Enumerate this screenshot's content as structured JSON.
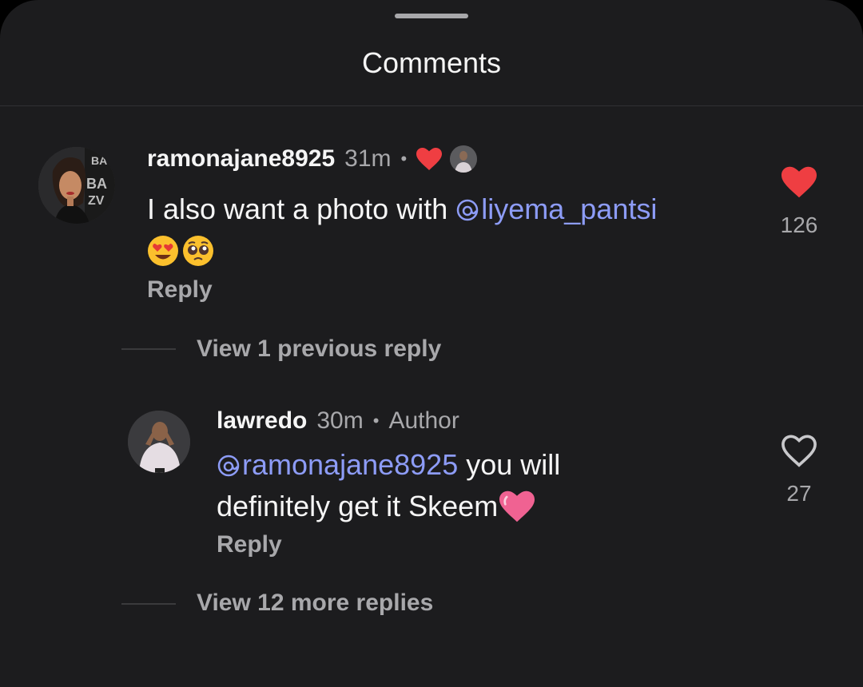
{
  "sheet": {
    "title": "Comments"
  },
  "comments": [
    {
      "username": "ramonajane8925",
      "time": "31m",
      "separator": "•",
      "text_before": "I also want a photo with ",
      "mention": "liyema_pantsi",
      "emojis": [
        "heart-eyes-emoji",
        "pleading-face-emoji"
      ],
      "reply_label": "Reply",
      "likes": "126",
      "liked": true,
      "liked_by_author": true,
      "view_replies_label": "View 1 previous reply"
    },
    {
      "username": "lawredo",
      "time": "30m",
      "separator": "•",
      "author_tag": "Author",
      "mention": "ramonajane8925",
      "text_after": " you will",
      "text_line2": "definitely get it Skeem",
      "emojis": [
        "pink-heart-emoji"
      ],
      "reply_label": "Reply",
      "likes": "27",
      "liked": false,
      "view_more_label": "View 12 more replies"
    }
  ],
  "colors": {
    "background": "#1c1c1e",
    "text": "#f5f5f5",
    "muted": "#a8a8ab",
    "mention": "#8d9cf7",
    "like": "#ef3e42"
  }
}
